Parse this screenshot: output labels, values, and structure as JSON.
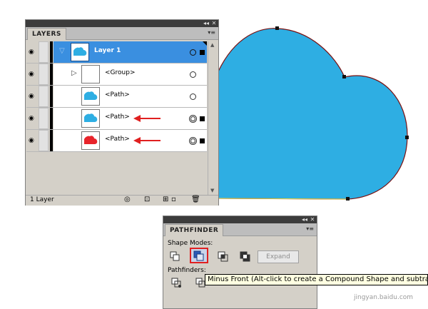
{
  "layers_panel": {
    "tab": "LAYERS",
    "rows": [
      {
        "name": "Layer 1"
      },
      {
        "name": "<Group>"
      },
      {
        "name": "<Path>"
      },
      {
        "name": "<Path>"
      },
      {
        "name": "<Path>"
      }
    ],
    "status": "1 Layer"
  },
  "pathfinder_panel": {
    "tab": "PATHFINDER",
    "shape_modes_label": "Shape Modes:",
    "pathfinders_label": "Pathfinders:",
    "expand_label": "Expand"
  },
  "tooltip": "Minus Front (Alt-click to create a Compound Shape and subtract)",
  "watermark": "jingyan.baidu.com",
  "colors": {
    "cloud_blue": "#2eaee3",
    "cloud_red": "#e8242b",
    "selection_blue": "#3a8fe0",
    "arrow_red": "#e02020"
  }
}
